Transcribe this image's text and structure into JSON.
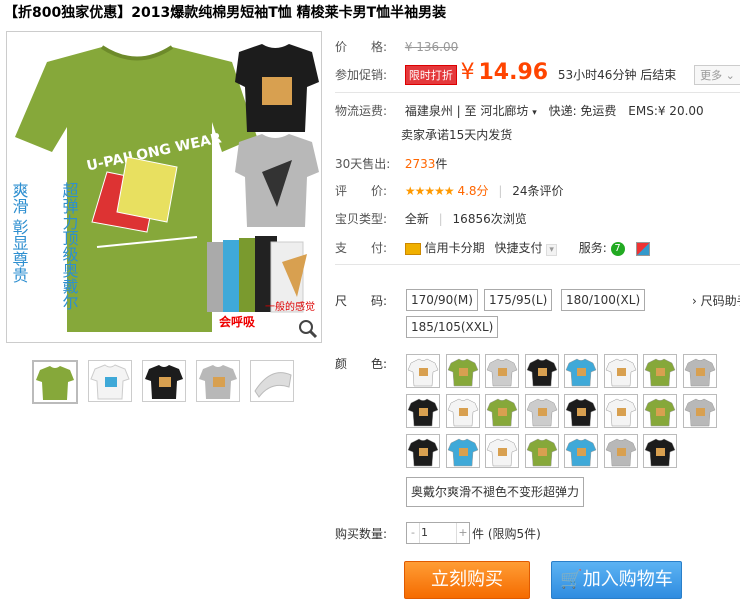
{
  "title": "【折800独家优惠】2013爆款纯棉男短袖T恤 精梭莱卡男T恤半袖男装",
  "price": {
    "label": "价　　格:",
    "original": "¥ 136.00"
  },
  "promo": {
    "label": "参加促销:",
    "badge": "限时打折",
    "currency": "¥",
    "price": "14.96",
    "countdown": "53小时46分钟 后结束",
    "more": "更多"
  },
  "shipping": {
    "label": "物流运费:",
    "from": "福建泉州",
    "to_sep": "至",
    "to": "河北廊坊",
    "express": "快递: 免运费",
    "ems": "EMS:¥ 20.00",
    "promise": "卖家承诺15天内发货"
  },
  "sales": {
    "label": "30天售出:",
    "count": "2733",
    "unit": "件"
  },
  "rating": {
    "label": "评　　价:",
    "stars": "★★★★★",
    "score": "4.8分",
    "sep": "|",
    "reviews": "24条评价"
  },
  "item_type": {
    "label": "宝贝类型:",
    "condition": "全新",
    "sep": "|",
    "views": "16856次浏览"
  },
  "payment": {
    "label": "支　　付:",
    "credit": "信用卡分期",
    "quick": "快捷支付",
    "service_label": "服务:"
  },
  "sizes": {
    "label": "尺　　码:",
    "options": [
      "170/90(M)",
      "175/95(L)",
      "180/100(XL)",
      "185/105(XXL)"
    ],
    "guide": "尺码助手"
  },
  "colors": {
    "label": "颜　　色:",
    "button": "奥戴尔爽滑不褪色不变形超弹力"
  },
  "quantity": {
    "label": "购买数量:",
    "minus": "-",
    "value": "1",
    "plus": "+",
    "unit_note": "件 (限购5件)"
  },
  "actions": {
    "buy": "立刻购买",
    "cart": "加入购物车"
  },
  "image_text": {
    "brand": "U-PAILONG WEAR",
    "vertical1": "超弹力顶级奥戴尔",
    "vertical2": "爽滑 彰显尊贵",
    "badge": "会呼吸",
    "badge2": "一般的感觉"
  },
  "colors_palette": {
    "accent": "#ff4400",
    "green": "#7a9a2e",
    "blue": "#3fa9d8"
  }
}
